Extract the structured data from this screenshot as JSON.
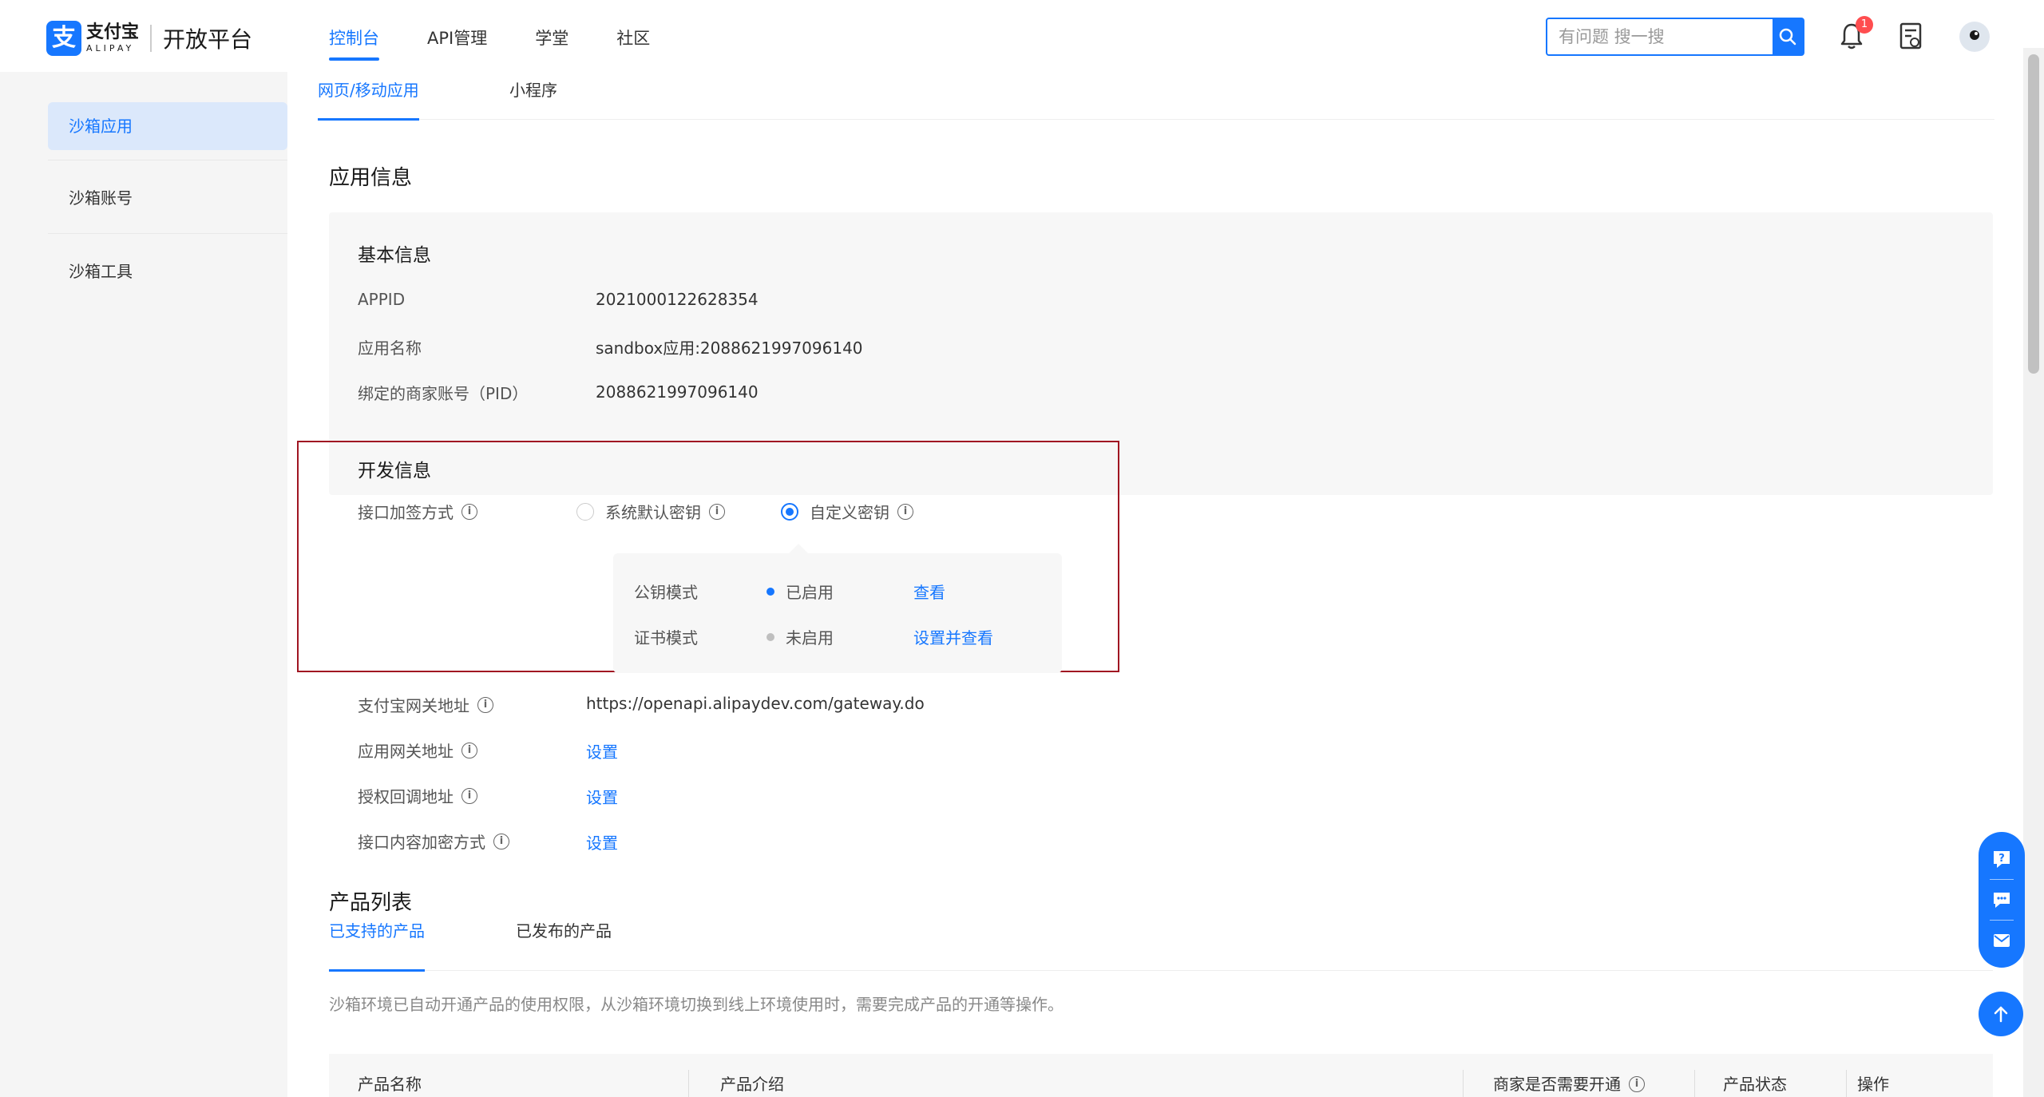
{
  "header": {
    "logo_char": "支",
    "logo_cn": "支付宝",
    "logo_en": "ALIPAY",
    "platform": "开放平台",
    "nav": [
      "控制台",
      "API管理",
      "学堂",
      "社区"
    ],
    "search_placeholder": "有问题 搜一搜",
    "notification_count": "1"
  },
  "sidebar": {
    "items": [
      "沙箱应用",
      "沙箱账号",
      "沙箱工具"
    ]
  },
  "tabs": [
    "网页/移动应用",
    "小程序"
  ],
  "app_info": {
    "title": "应用信息",
    "basic_title": "基本信息",
    "rows": [
      {
        "label": "APPID",
        "value": "2021000122628354"
      },
      {
        "label": "应用名称",
        "value": "sandbox应用:2088621997096140"
      },
      {
        "label": "绑定的商家账号（PID）",
        "value": "2088621997096140"
      }
    ]
  },
  "dev_info": {
    "title": "开发信息",
    "sign_label": "接口加签方式",
    "option_default": "系统默认密钥",
    "option_custom": "自定义密钥",
    "key_modes": [
      {
        "name": "公钥模式",
        "status": "已启用",
        "action": "查看"
      },
      {
        "name": "证书模式",
        "status": "未启用",
        "action": "设置并查看"
      }
    ],
    "gateway_label": "支付宝网关地址",
    "gateway_value": "https://openapi.alipaydev.com/gateway.do",
    "app_gateway_label": "应用网关地址",
    "callback_label": "授权回调地址",
    "encrypt_label": "接口内容加密方式",
    "set_label": "设置"
  },
  "products": {
    "title": "产品列表",
    "tabs": [
      "已支持的产品",
      "已发布的产品"
    ],
    "hint": "沙箱环境已自动开通产品的使用权限，从沙箱环境切换到线上环境使用时，需要完成产品的开通等操作。",
    "columns": [
      "产品名称",
      "产品介绍",
      "商家是否需要开通",
      "产品状态",
      "操作"
    ]
  },
  "colors": {
    "primary": "#1677ff",
    "highlight_border": "#a01622",
    "enabled_dot": "#1677ff",
    "disabled_dot": "#bfbfbf"
  }
}
